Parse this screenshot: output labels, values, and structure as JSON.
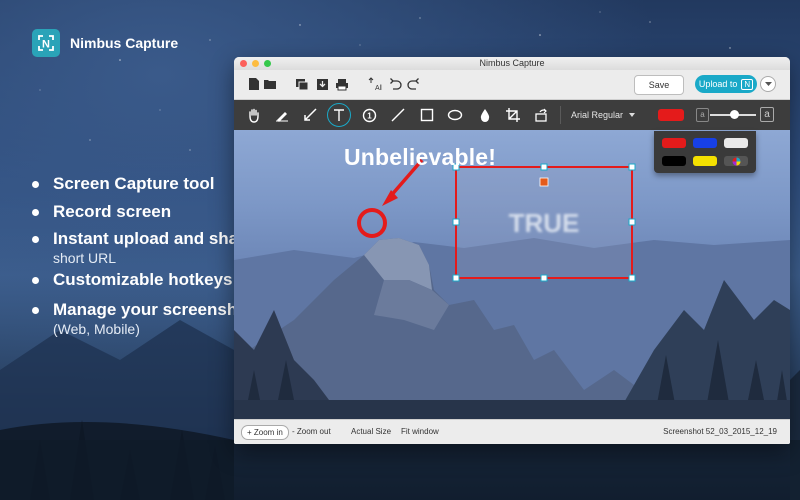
{
  "brand": {
    "name": "Nimbus Capture",
    "logo_letter": "N"
  },
  "features": [
    {
      "label": "Screen Capture tool",
      "sub": ""
    },
    {
      "label": "Record screen",
      "sub": ""
    },
    {
      "label": "Instant upload and share",
      "sub": "short URL"
    },
    {
      "label": "Customizable hotkeys",
      "sub": ""
    },
    {
      "label": "Manage your screenshots",
      "sub": "(Web, Mobile)"
    }
  ],
  "window": {
    "title": "Nimbus Capture",
    "toolbar": {
      "save_label": "Save",
      "upload_label": "Upload to",
      "upload_badge": "N",
      "icons": [
        "new-file-icon",
        "open-folder-icon",
        "capture-screen-icon",
        "download-icon",
        "print-icon",
        "auto-size-icon",
        "undo-icon",
        "redo-icon"
      ]
    },
    "edit_toolbar": {
      "tools": [
        "hand-icon",
        "pen-icon",
        "arrow-icon",
        "text-icon",
        "numbered-step-icon",
        "line-icon",
        "rectangle-icon",
        "ellipse-icon",
        "blur-icon",
        "crop-icon",
        "rotate-icon"
      ],
      "selected_tool": "text-icon",
      "font": "Arial Regular",
      "size_small_label": "a",
      "size_large_label": "a",
      "size_level": 0.45,
      "current_color": "#e41b1b"
    },
    "palette": [
      "#e41b1b",
      "#1740e6",
      "#e9e9e9",
      "#000000",
      "#f4e000",
      "multicolor"
    ],
    "annotations": {
      "arrow_text": "Unbelievable!",
      "blurred_text": "TRUE"
    },
    "statusbar": {
      "zoom_in": "+ Zoom in",
      "zoom_out": "- Zoom out",
      "actual_size": "Actual Size",
      "fit_window": "Fit window",
      "filename": "Screenshot 52_03_2015_12_19"
    }
  },
  "colors": {
    "accent": "#1aa9c8",
    "annotation_red": "#e41b1b"
  }
}
